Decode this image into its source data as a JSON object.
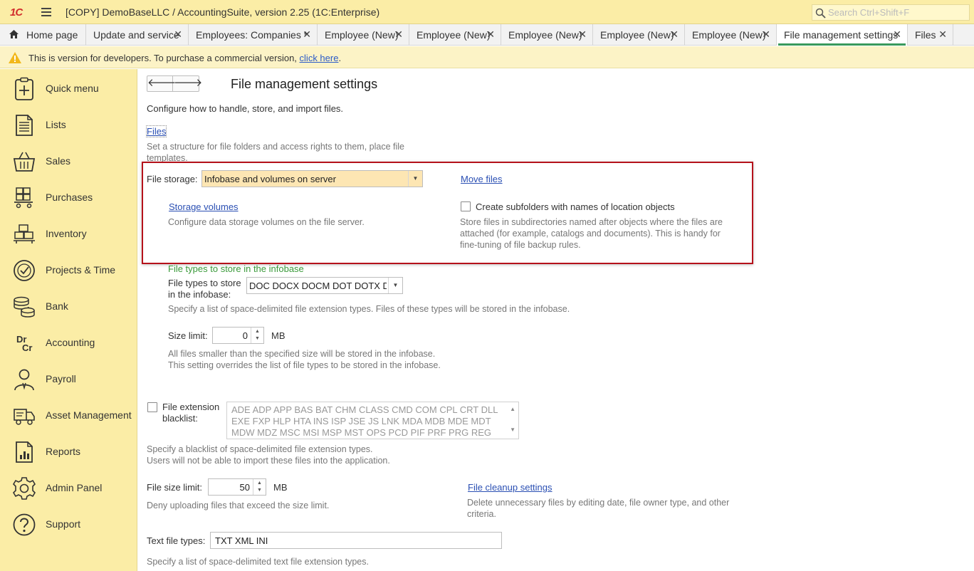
{
  "titlebar": {
    "logo": "1C",
    "app_title": "[COPY] DemoBaseLLC / AccountingSuite, version 2.25  (1C:Enterprise)",
    "search_placeholder": "Search Ctrl+Shift+F"
  },
  "tabs": [
    {
      "label": "Home page",
      "icon": "home-icon"
    },
    {
      "label": "Update and service",
      "close": "✕"
    },
    {
      "label": "Employees: Companies *",
      "close": "✕"
    },
    {
      "label": "Employee (New)",
      "close": "✕"
    },
    {
      "label": "Employee (New)",
      "close": "✕"
    },
    {
      "label": "Employee (New)",
      "close": "✕"
    },
    {
      "label": "Employee (New)",
      "close": "✕"
    },
    {
      "label": "Employee (New)",
      "close": "✕"
    },
    {
      "label": "File management settings",
      "close": "✕",
      "active": true
    },
    {
      "label": "Files",
      "close": "✕"
    }
  ],
  "banner": {
    "text": "This is version for developers. To purchase a commercial version,",
    "link": "click here",
    "suffix": "."
  },
  "sidebar": {
    "items": [
      {
        "label": "Quick menu",
        "icon": "quick-menu-icon"
      },
      {
        "label": "Lists",
        "icon": "lists-icon"
      },
      {
        "label": "Sales",
        "icon": "basket-icon"
      },
      {
        "label": "Purchases",
        "icon": "cart-icon"
      },
      {
        "label": "Inventory",
        "icon": "boxes-icon"
      },
      {
        "label": "Projects & Time",
        "icon": "clock-icon"
      },
      {
        "label": "Bank",
        "icon": "coins-icon"
      },
      {
        "label": "Accounting",
        "icon": "dr-cr-icon"
      },
      {
        "label": "Payroll",
        "icon": "person-icon"
      },
      {
        "label": "Asset Management",
        "icon": "truck-icon"
      },
      {
        "label": "Reports",
        "icon": "report-icon"
      },
      {
        "label": "Admin Panel",
        "icon": "gear-icon"
      },
      {
        "label": "Support",
        "icon": "help-icon"
      }
    ],
    "dr": "Dr",
    "cr": "Cr"
  },
  "page": {
    "back": "🡐",
    "forward": "🡒",
    "title": "File management settings",
    "intro": "Configure how to handle, store, and import files.",
    "files_link": "Files",
    "files_hint_1": "Set a structure for file folders and access rights to them, place file",
    "files_hint_2": "templates.",
    "file_storage_label": "File storage:",
    "file_storage_value": "Infobase and volumes on server",
    "move_files_link": "Move files",
    "storage_volumes_link": "Storage volumes",
    "storage_volumes_hint": "Configure data storage volumes on the file server.",
    "subfolders_label": "Create subfolders with names of location objects",
    "subfolders_hint_1": "Store files in subdirectories named after objects where the files are",
    "subfolders_hint_2": "attached (for example, catalogs and documents). This is handy for",
    "subfolders_hint_3": "fine-tuning of file backup rules.",
    "infobase_group": "File types to store in the infobase",
    "types_label_1": "File types to store",
    "types_label_2": "in the infobase:",
    "types_value": "DOC DOCX DOCM DOT DOTX D",
    "types_hint": "Specify a list of space-delimited file extension types. Files of these types will be stored in the infobase.",
    "size_limit_label": "Size limit:",
    "size_limit_value": "0",
    "size_unit": "MB",
    "size_hint_1": "All files smaller than the specified size will be stored in the infobase.",
    "size_hint_2": "This setting overrides the list of file types to be stored in the infobase.",
    "blacklist_label_1": "File extension",
    "blacklist_label_2": "blacklist:",
    "blacklist_lines": [
      "ADE ADP APP BAS BAT CHM CLASS CMD COM CPL CRT DLL",
      "EXE FXP HLP HTA INS ISP JSE JS LNK MDA MDB MDE MDT",
      "MDW MDZ MSC MSI MSP MST OPS PCD PIF PRF PRG REG"
    ],
    "blacklist_hint_1": "Specify a blacklist of space-delimited file extension types.",
    "blacklist_hint_2": "Users will not be able to import these files into the application.",
    "file_size_limit_label": "File size limit:",
    "file_size_limit_value": "50",
    "file_size_unit": "MB",
    "file_size_hint": "Deny uploading files that exceed the size limit.",
    "cleanup_link": "File cleanup settings",
    "cleanup_hint_1": "Delete unnecessary files by editing date, file owner type, and other",
    "cleanup_hint_2": "criteria.",
    "text_types_label": "Text file types:",
    "text_types_value": "TXT XML INI",
    "text_types_hint_1": "Specify a list of space-delimited text file extension types."
  }
}
